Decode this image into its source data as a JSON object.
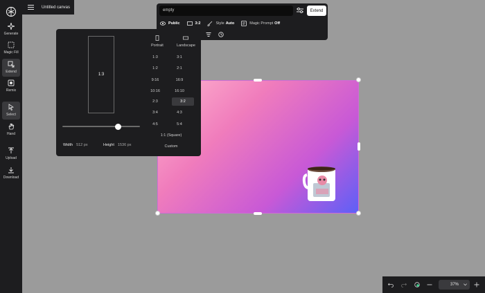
{
  "app": {
    "canvas_title": "Untitled canvas"
  },
  "sidebar": {
    "tools": [
      {
        "label": "Generate",
        "icon": "sparkle-icon"
      },
      {
        "label": "Magic Fill",
        "icon": "magic-fill-icon"
      },
      {
        "label": "Extend",
        "icon": "extend-icon",
        "active": true
      },
      {
        "label": "Remix",
        "icon": "remix-icon"
      },
      {
        "label": "Select",
        "icon": "cursor-icon",
        "active": true
      },
      {
        "label": "Hand",
        "icon": "hand-icon"
      },
      {
        "label": "Upload",
        "icon": "upload-icon"
      },
      {
        "label": "Download",
        "icon": "download-icon"
      }
    ]
  },
  "prompt": {
    "value": "empty",
    "extend_label": "Extend",
    "visibility_label": "Public",
    "aspect_label": "3:2",
    "style_label": "Style",
    "style_value": "Auto",
    "magic_prompt_label": "Magic Prompt",
    "magic_prompt_value": "Off"
  },
  "aspect_panel": {
    "preview_label": "1:3",
    "portrait_label": "Portrait",
    "landscape_label": "Landscape",
    "portrait_ratios": [
      "1:3",
      "1:2",
      "9:16",
      "10:16",
      "2:3",
      "3:4",
      "4:5"
    ],
    "landscape_ratios": [
      "3:1",
      "2:1",
      "16:9",
      "16:10",
      "3:2",
      "4:3",
      "5:4"
    ],
    "selected": "3:2",
    "square_label": "1:1 (Square)",
    "custom_label": "Custom",
    "width_label": "Width",
    "width_value": "512 px",
    "height_label": "Height",
    "height_value": "1536 px",
    "slider_fraction": 0.78
  },
  "zoom": {
    "value": "37%"
  },
  "colors": {
    "accent": "#ffffff",
    "panel": "#1d1d1f",
    "canvas_bg": "#9b9b9b"
  }
}
